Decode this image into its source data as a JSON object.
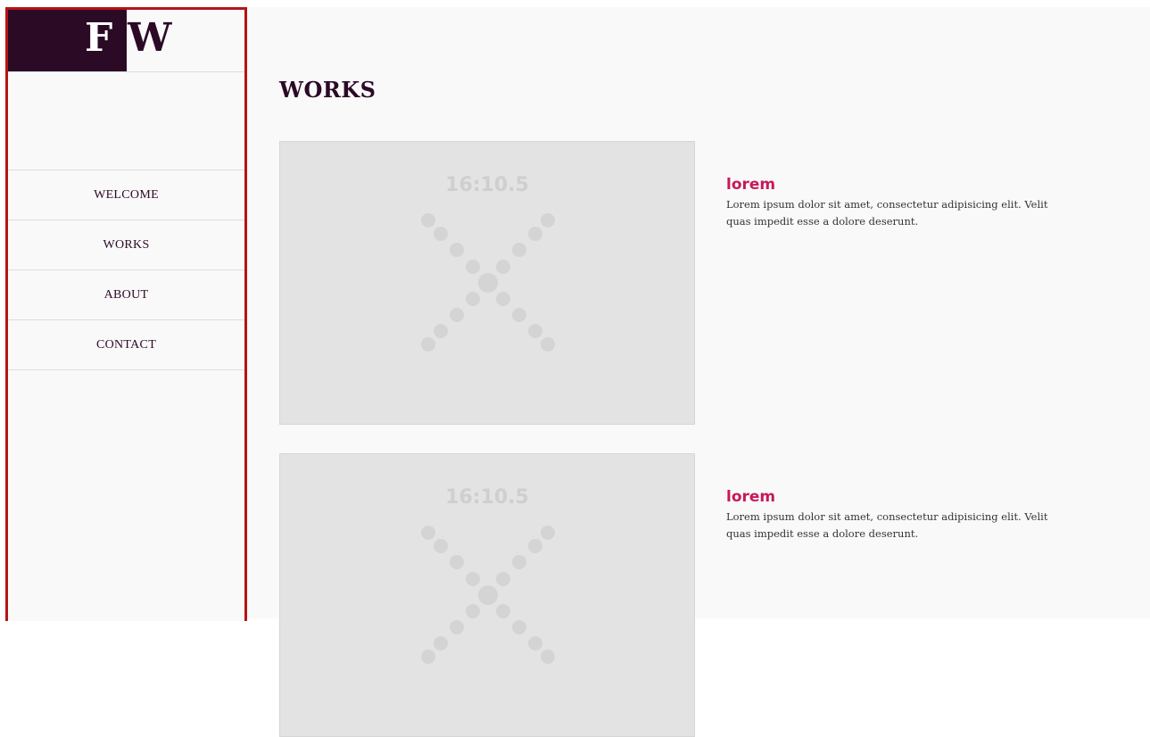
{
  "logo": {
    "left_letter": "F",
    "right_letter": "W"
  },
  "nav": {
    "items": [
      {
        "label": "WELCOME"
      },
      {
        "label": "WORKS"
      },
      {
        "label": "ABOUT"
      },
      {
        "label": "CONTACT"
      }
    ]
  },
  "main": {
    "title": "WORKS",
    "works": [
      {
        "thumbnail_label": "16:10.5",
        "title": "lorem",
        "description": "Lorem ipsum dolor sit amet, consectetur adipisicing elit. Velit quas impedit esse a dolore deserunt."
      },
      {
        "thumbnail_label": "16:10.5",
        "title": "lorem",
        "description": "Lorem ipsum dolor sit amet, consectetur adipisicing elit. Velit quas impedit esse a dolore deserunt."
      }
    ]
  },
  "colors": {
    "brand_dark": "#2b0a26",
    "accent": "#c8195a",
    "sidebar_border": "#b51416",
    "placeholder_bg": "#e3e3e3"
  }
}
